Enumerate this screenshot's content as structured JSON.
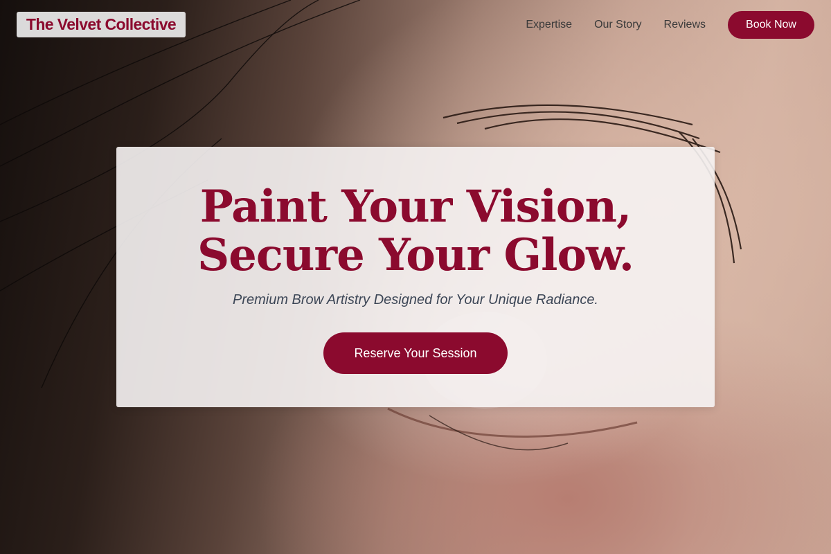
{
  "header": {
    "brand": "The Velvet Collective",
    "nav": [
      {
        "label": "Expertise"
      },
      {
        "label": "Our Story"
      },
      {
        "label": "Reviews"
      }
    ],
    "book_label": "Book Now"
  },
  "hero": {
    "headline_line1": "Paint Your Vision,",
    "headline_line2": "Secure Your Glow.",
    "subtitle": "Premium Brow Artistry Designed for Your Unique Radiance.",
    "cta_label": "Reserve Your Session",
    "background": "eye-closeup-photo"
  },
  "colors": {
    "brand": "#8b0a2e",
    "text_dark": "#3a3a3a",
    "subtitle": "#3c4656"
  }
}
